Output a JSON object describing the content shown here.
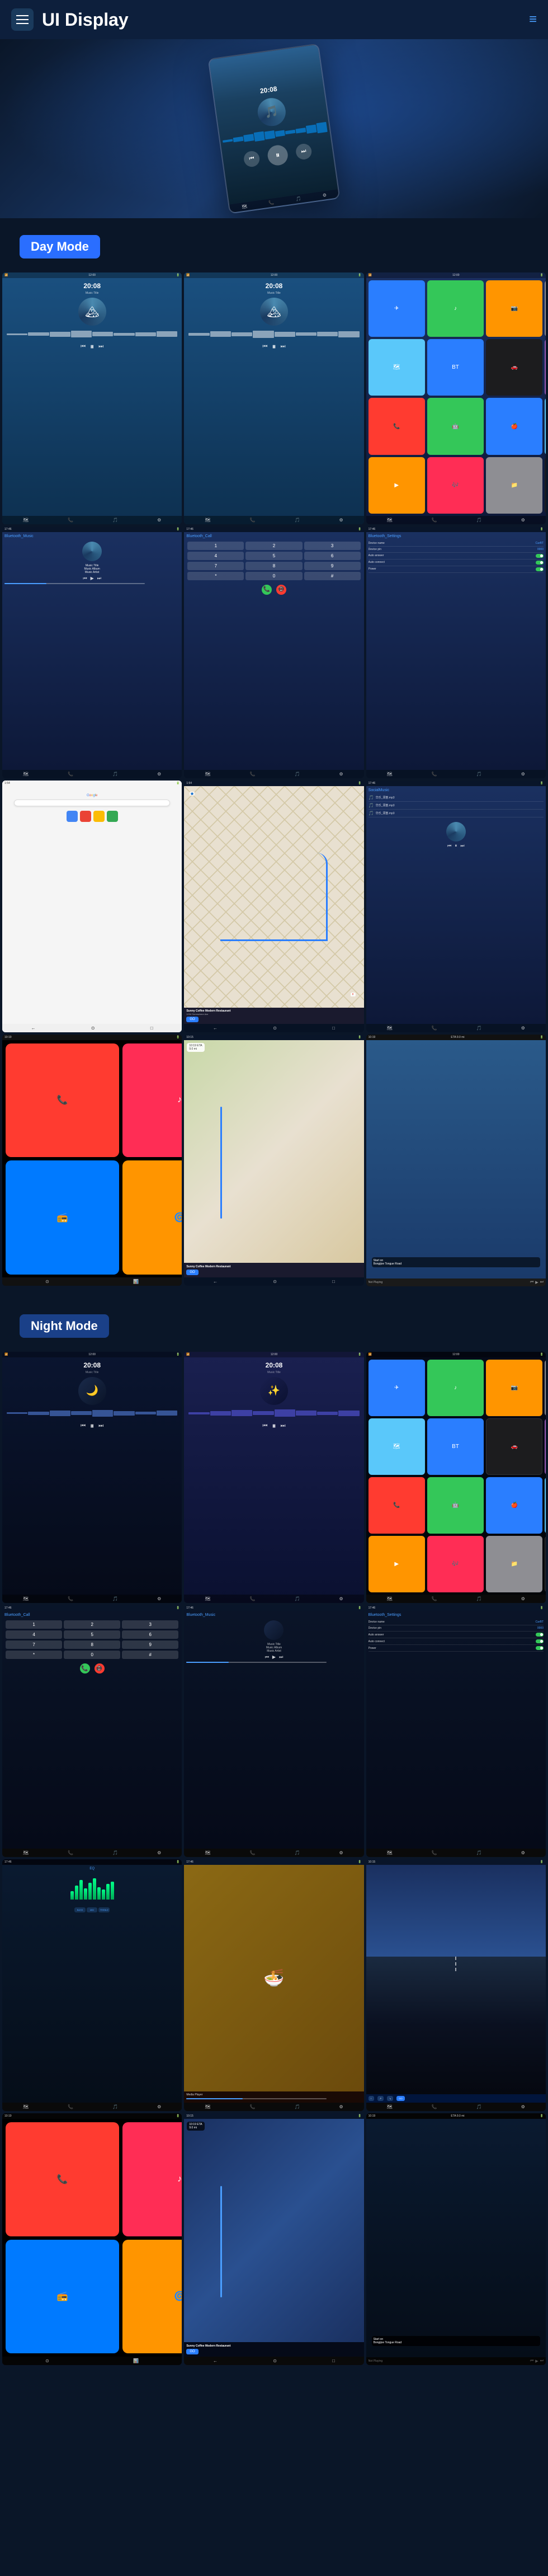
{
  "header": {
    "title": "UI Display",
    "menu_icon": "☰",
    "nav_icon": "≡"
  },
  "sections": {
    "day_mode": "Day Mode",
    "night_mode": "Night Mode"
  },
  "player": {
    "time": "20:08",
    "music_title": "Music Title",
    "music_album": "Music Album",
    "music_artist": "Music Artist"
  },
  "settings": {
    "title": "Bluetooth_Settings",
    "device_name_label": "Device name",
    "device_name_value": "CarBT",
    "device_pin_label": "Device pin",
    "device_pin_value": "0000",
    "auto_answer_label": "Auto answer",
    "auto_connect_label": "Auto connect",
    "power_label": "Power"
  },
  "navigation": {
    "destination": "Sunny Coffee Modern Restaurant",
    "address": "1234 Somewhere Ave",
    "go": "GO",
    "eta_label": "10:19 ETA",
    "distance": "9.0 mi",
    "not_playing": "Not Playing"
  },
  "bottom_icons": [
    "NAVI",
    "PHONE",
    "SIRI",
    "DVD",
    "APS"
  ],
  "eq_heights": [
    15,
    25,
    35,
    20,
    30,
    38,
    22,
    18,
    28,
    32,
    24,
    16
  ],
  "wave_heights": [
    4,
    8,
    12,
    16,
    14,
    10,
    6,
    8,
    14,
    18,
    16,
    12,
    8,
    10,
    14,
    16,
    12,
    8,
    6
  ]
}
